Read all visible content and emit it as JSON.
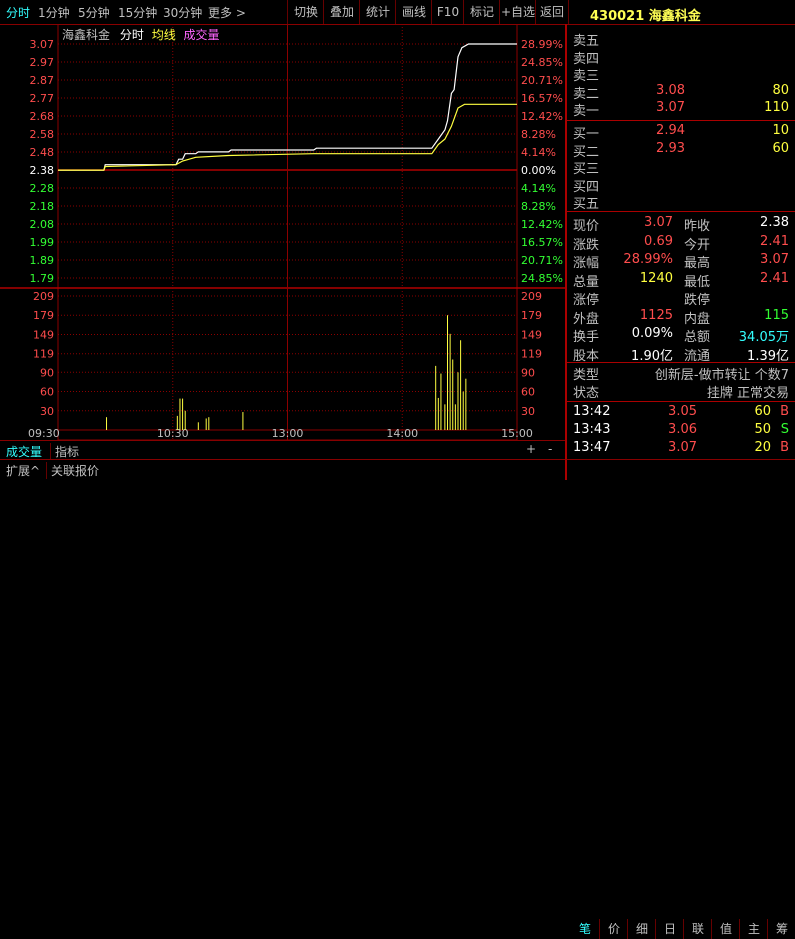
{
  "toolbar": {
    "periods": [
      "分时",
      "1分钟",
      "5分钟",
      "15分钟",
      "30分钟",
      "更多 >"
    ],
    "buttons": [
      "切换",
      "叠加",
      "统计",
      "画线",
      "F10",
      "标记",
      "+自选",
      "返回"
    ],
    "stock_title": "430021  海鑫科金"
  },
  "chart_header": {
    "name": "海鑫科金",
    "mode": "分时",
    "avg_line": "均线",
    "volume": "成交量"
  },
  "colors": {
    "up": "#ff4d4d",
    "down": "#33ff33",
    "flat": "#ffffff",
    "price_line": "#ffffff",
    "avg_line": "#ffff40",
    "grid": "#8b0000",
    "accent": "#33ffff"
  },
  "chart_data": {
    "type": "line",
    "price_axis": {
      "left": [
        "3.07",
        "2.97",
        "2.87",
        "2.77",
        "2.68",
        "2.58",
        "2.48",
        "2.38",
        "2.28",
        "2.18",
        "2.08",
        "1.99",
        "1.89",
        "1.79"
      ],
      "right": [
        "28.99%",
        "24.85%",
        "20.71%",
        "16.57%",
        "12.42%",
        "8.28%",
        "4.14%",
        "0.00%",
        "4.14%",
        "8.28%",
        "12.42%",
        "16.57%",
        "20.71%",
        "24.85%"
      ],
      "ylim": [
        1.79,
        3.07
      ],
      "prev_close": 2.38
    },
    "volume_axis": {
      "ticks": [
        "209",
        "179",
        "149",
        "119",
        "90",
        "60",
        "30"
      ],
      "ylim": [
        0,
        209
      ]
    },
    "x_ticks": [
      "09:30",
      "10:30",
      "13:00",
      "14:00",
      "15:00"
    ],
    "series": [
      {
        "name": "分时",
        "points": [
          [
            0,
            2.38
          ],
          [
            35,
            2.38
          ],
          [
            36,
            2.41
          ],
          [
            90,
            2.41
          ],
          [
            92,
            2.44
          ],
          [
            95,
            2.44
          ],
          [
            97,
            2.47
          ],
          [
            105,
            2.47
          ],
          [
            107,
            2.48
          ],
          [
            130,
            2.48
          ],
          [
            132,
            2.49
          ],
          [
            195,
            2.49
          ],
          [
            197,
            2.5
          ],
          [
            285,
            2.5
          ],
          [
            290,
            2.55
          ],
          [
            295,
            2.6
          ],
          [
            297,
            2.65
          ],
          [
            300,
            2.8
          ],
          [
            302,
            2.82
          ],
          [
            305,
            3.0
          ],
          [
            308,
            3.05
          ],
          [
            313,
            3.07
          ],
          [
            350,
            3.07
          ]
        ]
      },
      {
        "name": "均线",
        "points": [
          [
            0,
            2.38
          ],
          [
            35,
            2.38
          ],
          [
            36,
            2.4
          ],
          [
            90,
            2.41
          ],
          [
            95,
            2.43
          ],
          [
            105,
            2.45
          ],
          [
            130,
            2.46
          ],
          [
            195,
            2.47
          ],
          [
            285,
            2.47
          ],
          [
            290,
            2.52
          ],
          [
            295,
            2.55
          ],
          [
            300,
            2.62
          ],
          [
            305,
            2.72
          ],
          [
            310,
            2.74
          ],
          [
            350,
            2.74
          ]
        ]
      }
    ],
    "volume_bars": [
      {
        "t": 37,
        "v": 20
      },
      {
        "t": 91,
        "v": 22
      },
      {
        "t": 93,
        "v": 49
      },
      {
        "t": 95,
        "v": 49
      },
      {
        "t": 97,
        "v": 30
      },
      {
        "t": 107,
        "v": 12
      },
      {
        "t": 113,
        "v": 18
      },
      {
        "t": 115,
        "v": 20
      },
      {
        "t": 141,
        "v": 28
      },
      {
        "t": 288,
        "v": 100
      },
      {
        "t": 290,
        "v": 50
      },
      {
        "t": 292,
        "v": 88
      },
      {
        "t": 295,
        "v": 40
      },
      {
        "t": 297,
        "v": 179
      },
      {
        "t": 299,
        "v": 150
      },
      {
        "t": 301,
        "v": 110
      },
      {
        "t": 303,
        "v": 40
      },
      {
        "t": 305,
        "v": 90
      },
      {
        "t": 307,
        "v": 140
      },
      {
        "t": 309,
        "v": 60
      },
      {
        "t": 311,
        "v": 80
      }
    ]
  },
  "order_book": {
    "asks": [
      {
        "label": "卖五",
        "price": "",
        "vol": ""
      },
      {
        "label": "卖四",
        "price": "",
        "vol": ""
      },
      {
        "label": "卖三",
        "price": "",
        "vol": ""
      },
      {
        "label": "卖二",
        "price": "3.08",
        "vol": "80"
      },
      {
        "label": "卖一",
        "price": "3.07",
        "vol": "110"
      }
    ],
    "bids": [
      {
        "label": "买一",
        "price": "2.94",
        "vol": "10"
      },
      {
        "label": "买二",
        "price": "2.93",
        "vol": "60"
      },
      {
        "label": "买三",
        "price": "",
        "vol": ""
      },
      {
        "label": "买四",
        "price": "",
        "vol": ""
      },
      {
        "label": "买五",
        "price": "",
        "vol": ""
      }
    ]
  },
  "quote": [
    {
      "l1": "现价",
      "v1": "3.07",
      "c1": "up",
      "l2": "昨收",
      "v2": "2.38",
      "c2": "flat"
    },
    {
      "l1": "涨跌",
      "v1": "0.69",
      "c1": "up",
      "l2": "今开",
      "v2": "2.41",
      "c2": "up"
    },
    {
      "l1": "涨幅",
      "v1": "28.99%",
      "c1": "up",
      "l2": "最高",
      "v2": "3.07",
      "c2": "up"
    },
    {
      "l1": "总量",
      "v1": "1240",
      "c1": "vol",
      "l2": "最低",
      "v2": "2.41",
      "c2": "up"
    },
    {
      "l1": "涨停",
      "v1": "",
      "c1": "flat",
      "l2": "跌停",
      "v2": "",
      "c2": "flat"
    },
    {
      "l1": "外盘",
      "v1": "1125",
      "c1": "up",
      "l2": "内盘",
      "v2": "115",
      "c2": "down"
    },
    {
      "l1": "换手",
      "v1": "0.09%",
      "c1": "flat",
      "l2": "总额",
      "v2": "34.05万",
      "c2": "accent"
    },
    {
      "l1": "股本",
      "v1": "1.90亿",
      "c1": "flat",
      "l2": "流通",
      "v2": "1.39亿",
      "c2": "flat"
    }
  ],
  "info": [
    {
      "label": "类型",
      "value": "创新层-做市转让 个数7"
    },
    {
      "label": "状态",
      "value": "挂牌 正常交易"
    }
  ],
  "ticks": [
    {
      "time": "13:42",
      "price": "3.05",
      "vol": "60",
      "side": "B"
    },
    {
      "time": "13:43",
      "price": "3.06",
      "vol": "50",
      "side": "S"
    },
    {
      "time": "13:47",
      "price": "3.07",
      "vol": "20",
      "side": "B"
    }
  ],
  "bottom": {
    "tabs": [
      "成交量",
      "指标"
    ],
    "tabs2": [
      "扩展^",
      "关联报价"
    ],
    "zoom_plus": "+",
    "zoom_minus": "-",
    "panel_tabs": [
      "笔",
      "价",
      "细",
      "日",
      "联",
      "值",
      "主",
      "筹"
    ]
  }
}
